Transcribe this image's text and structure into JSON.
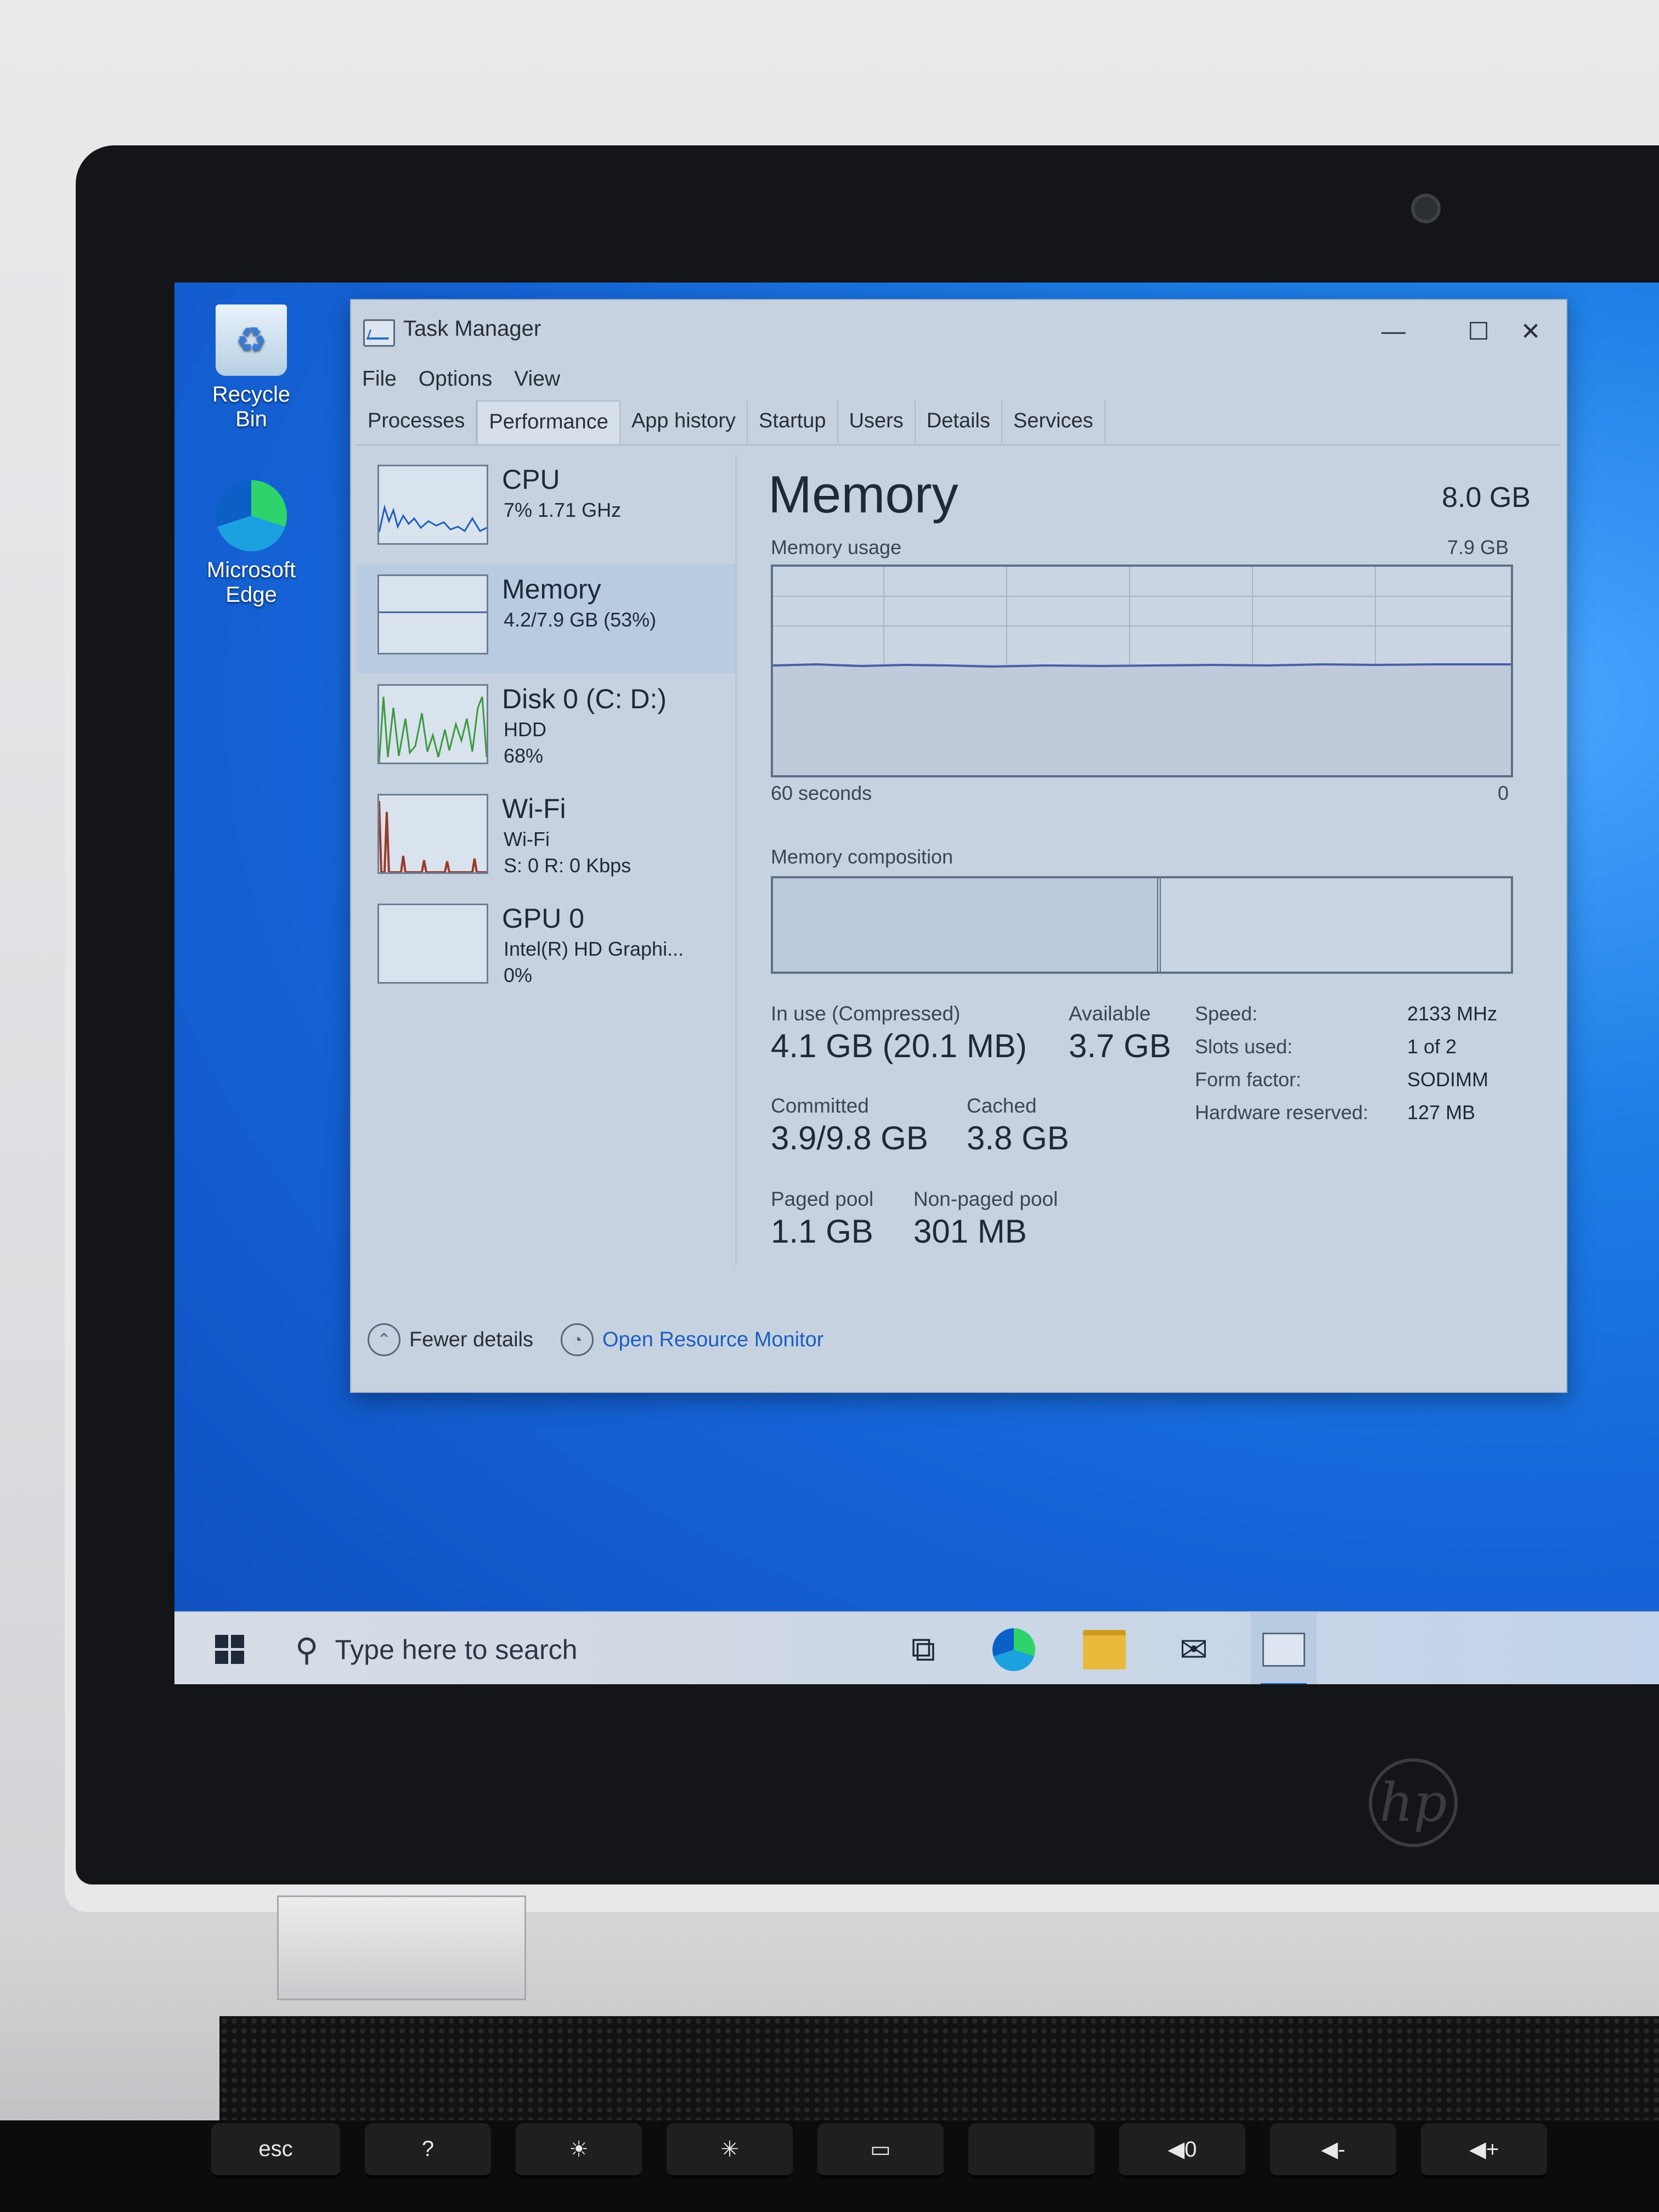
{
  "desktop": {
    "icons": [
      {
        "label": "Recycle Bin",
        "icon": "recycle-bin-icon"
      },
      {
        "label": "Microsoft Edge",
        "icon": "edge-icon"
      }
    ]
  },
  "window": {
    "title": "Task Manager",
    "controls": {
      "minimize": "—",
      "maximize": "☐",
      "close": "✕"
    },
    "menu": [
      "File",
      "Options",
      "View"
    ],
    "tabs": [
      "Processes",
      "Performance",
      "App history",
      "Startup",
      "Users",
      "Details",
      "Services"
    ],
    "active_tab": "Performance"
  },
  "sidebar": {
    "items": [
      {
        "name": "CPU",
        "sub1": "7% 1.71 GHz",
        "sub2": ""
      },
      {
        "name": "Memory",
        "sub1": "4.2/7.9 GB (53%)",
        "sub2": ""
      },
      {
        "name": "Disk 0 (C: D:)",
        "sub1": "HDD",
        "sub2": "68%"
      },
      {
        "name": "Wi-Fi",
        "sub1": "Wi-Fi",
        "sub2": "S: 0 R: 0 Kbps"
      },
      {
        "name": "GPU 0",
        "sub1": "Intel(R) HD Graphi...",
        "sub2": "0%"
      }
    ],
    "selected": "Memory"
  },
  "memory": {
    "title": "Memory",
    "total": "8.0 GB",
    "usage_label": "Memory usage",
    "usage_max": "7.9 GB",
    "time_left": "60 seconds",
    "time_right": "0",
    "composition_label": "Memory composition",
    "stats": {
      "in_use_label": "In use (Compressed)",
      "in_use_value": "4.1 GB (20.1 MB)",
      "available_label": "Available",
      "available_value": "3.7 GB",
      "committed_label": "Committed",
      "committed_value": "3.9/9.8 GB",
      "cached_label": "Cached",
      "cached_value": "3.8 GB",
      "paged_label": "Paged pool",
      "paged_value": "1.1 GB",
      "nonpaged_label": "Non-paged pool",
      "nonpaged_value": "301 MB"
    },
    "specs": [
      {
        "label": "Speed:",
        "value": "2133 MHz"
      },
      {
        "label": "Slots used:",
        "value": "1 of 2"
      },
      {
        "label": "Form factor:",
        "value": "SODIMM"
      },
      {
        "label": "Hardware reserved:",
        "value": "127 MB"
      }
    ]
  },
  "footer": {
    "fewer_details": "Fewer details",
    "open_resource_monitor": "Open Resource Monitor"
  },
  "taskbar": {
    "search_placeholder": "Type here to search",
    "pinned": [
      "task-view-icon",
      "edge-icon",
      "file-explorer-icon",
      "mail-icon",
      "task-manager-icon"
    ]
  },
  "keyboard": {
    "keys": [
      "esc",
      "?",
      "☀",
      "✳",
      "▭",
      "",
      "◀0",
      "◀-",
      "◀+"
    ]
  },
  "brand": {
    "logo": "hp"
  },
  "colors": {
    "accent": "#1a5fc4",
    "desktop": "#1565d8",
    "selected": "#b9cbe0"
  }
}
